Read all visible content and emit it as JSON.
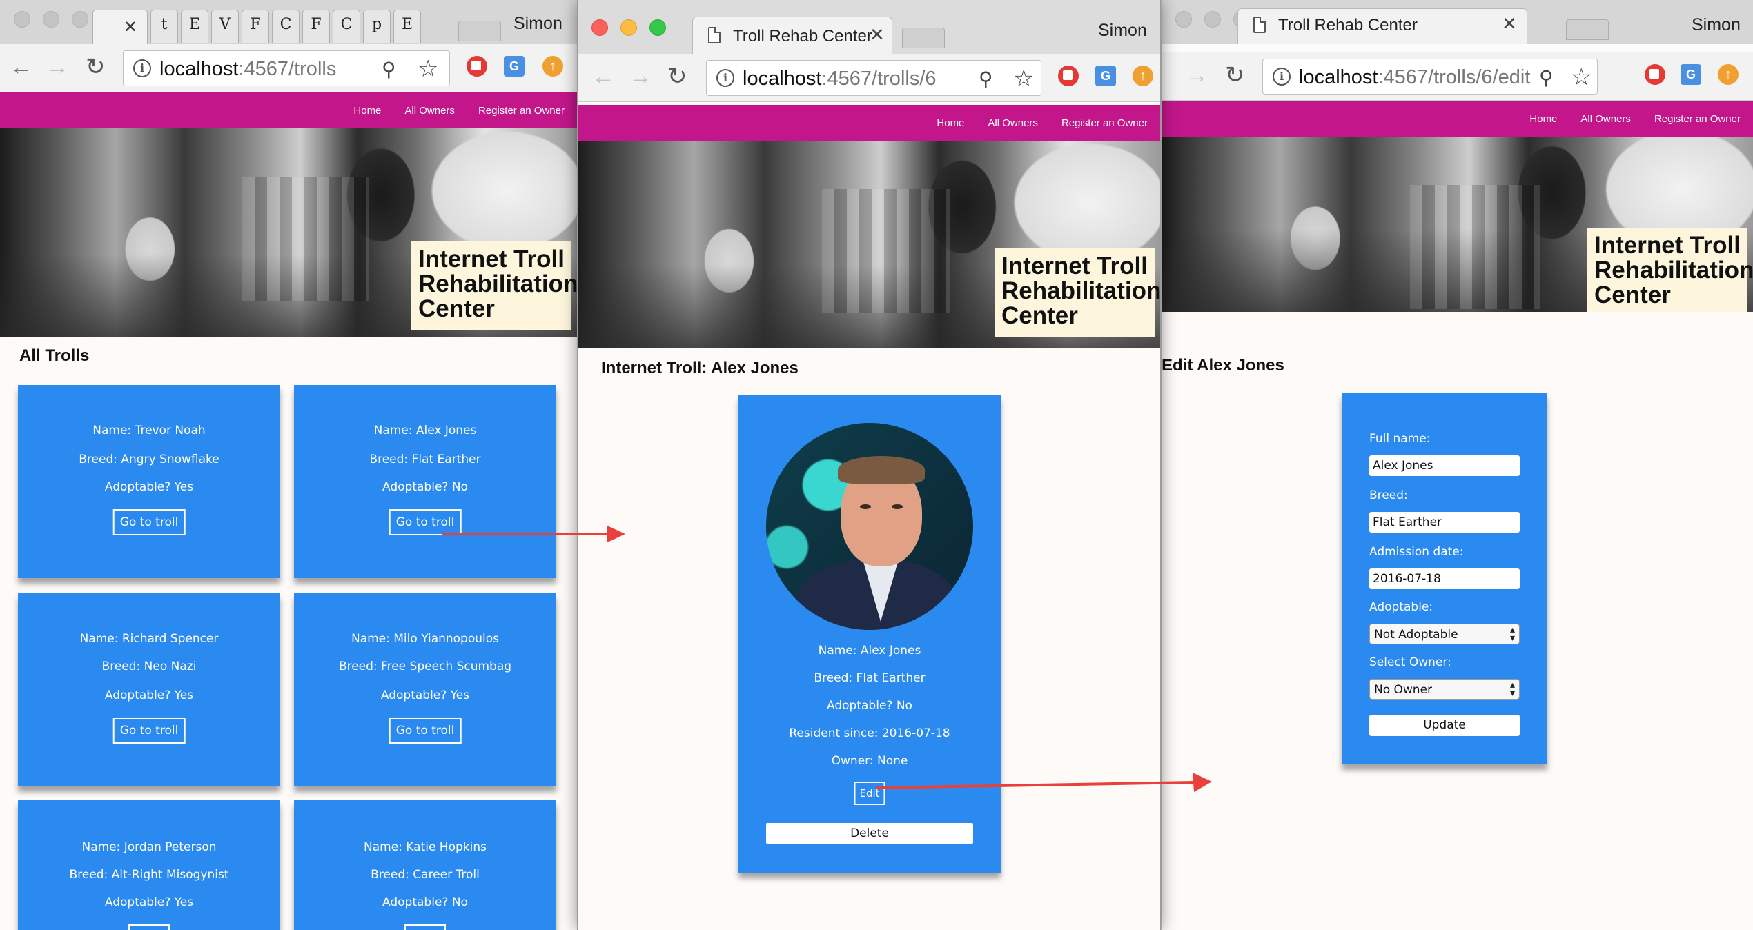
{
  "left_window": {
    "mini_tabs": [
      "t",
      "E",
      "V",
      "F",
      "C",
      "F",
      "C",
      "p",
      "E"
    ],
    "profile": "Simon",
    "url_host": "localhost",
    "url_path": ":4567/trolls",
    "nav": [
      "Home",
      "All Owners",
      "Register an Owner"
    ],
    "hero_title": "Internet Troll Rehabilitation Center",
    "heading": "All Trolls",
    "button_label": "Go to troll",
    "trolls": [
      {
        "name": "Name: Trevor Noah",
        "breed": "Breed: Angry Snowflake",
        "adoptable": "Adoptable? Yes"
      },
      {
        "name": "Name: Alex Jones",
        "breed": "Breed: Flat Earther",
        "adoptable": "Adoptable? No"
      },
      {
        "name": "Name: Richard Spencer",
        "breed": "Breed: Neo Nazi",
        "adoptable": "Adoptable? Yes"
      },
      {
        "name": "Name: Milo Yiannopoulos",
        "breed": "Breed: Free Speech Scumbag",
        "adoptable": "Adoptable? Yes"
      },
      {
        "name": "Name: Jordan Peterson",
        "breed": "Breed: Alt-Right Misogynist",
        "adoptable": "Adoptable? Yes"
      },
      {
        "name": "Name: Katie Hopkins",
        "breed": "Breed: Career Troll",
        "adoptable": "Adoptable? No"
      }
    ]
  },
  "middle_window": {
    "tab_title": "Troll Rehab Center",
    "profile": "Simon",
    "url_host": "localhost",
    "url_path": ":4567/trolls/6",
    "nav": [
      "Home",
      "All Owners",
      "Register an Owner"
    ],
    "hero_title": "Internet Troll Rehabilitation Center",
    "heading": "Internet Troll: Alex Jones",
    "details": {
      "name": "Name: Alex Jones",
      "breed": "Breed: Flat Earther",
      "adoptable": "Adoptable? No",
      "resident": "Resident since: 2016-07-18",
      "owner": "Owner: None"
    },
    "edit_label": "Edit",
    "delete_label": "Delete"
  },
  "right_window": {
    "tab_title": "Troll Rehab Center",
    "profile": "Simon",
    "url_host": "localhost",
    "url_path": ":4567/trolls/6/edit",
    "nav": [
      "Home",
      "All Owners",
      "Register an Owner"
    ],
    "hero_title": "Internet Troll Rehabilitation Center",
    "heading": "Edit Alex Jones",
    "form": {
      "full_name_label": "Full name:",
      "full_name_value": "Alex Jones",
      "breed_label": "Breed:",
      "breed_value": "Flat Earther",
      "admission_label": "Admission date:",
      "admission_value": "2016-07-18",
      "adoptable_label": "Adoptable:",
      "adoptable_value": "Not Adoptable",
      "owner_label": "Select Owner:",
      "owner_value": "No Owner",
      "update_label": "Update"
    }
  },
  "colors": {
    "nav_bg": "#c2168a",
    "card_bg": "#2b8af0",
    "hero_title_bg": "#fdf6dc",
    "arrow": "#e8403a"
  },
  "icons": [
    "back-icon",
    "forward-icon",
    "reload-icon",
    "info-icon",
    "zoom-icon",
    "star-icon",
    "stop-extension-icon",
    "translate-extension-icon",
    "upload-extension-icon",
    "document-icon",
    "close-icon"
  ]
}
